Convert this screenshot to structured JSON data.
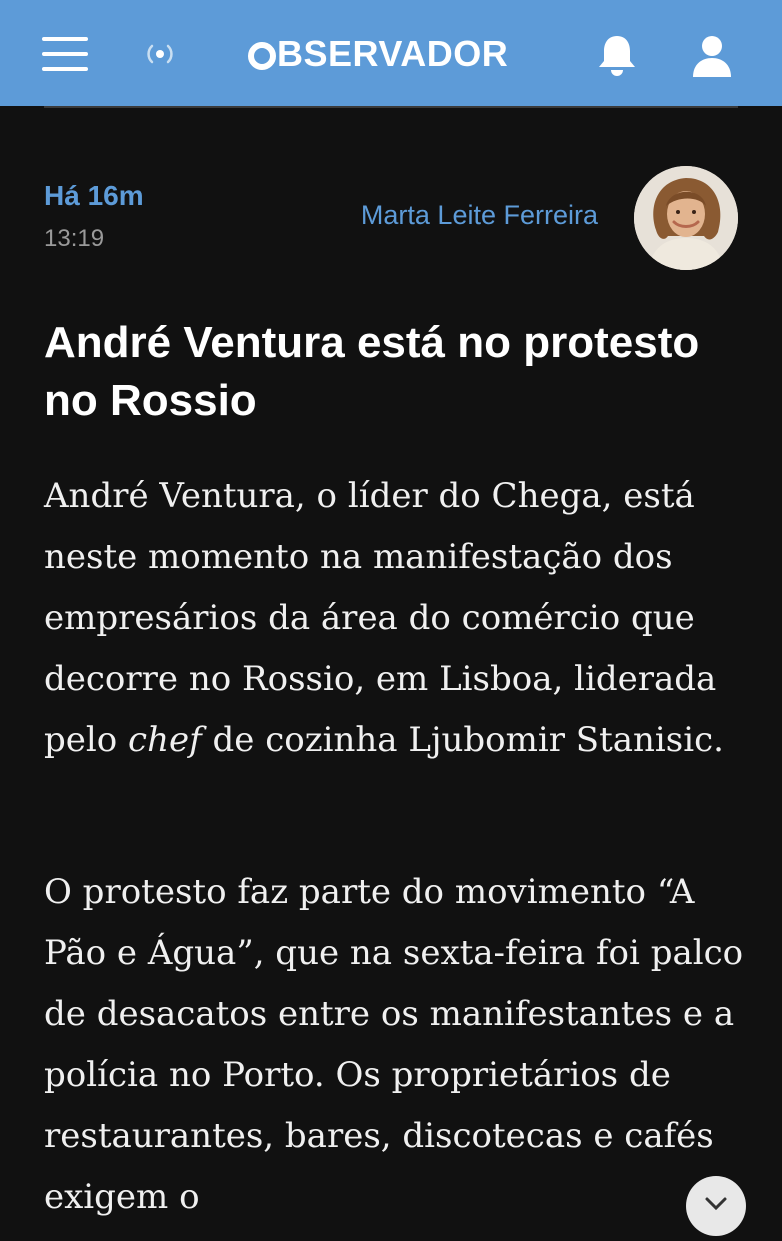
{
  "header": {
    "menu_icon": "hamburger-menu-icon",
    "live_icon": "live-radio-icon",
    "logo_text": "BSERVADOR",
    "notification_icon": "bell-icon",
    "profile_icon": "user-icon",
    "bar_color": "#5d9bd8"
  },
  "post": {
    "time_ago": "Há 16m",
    "time": "13:19",
    "author": "Marta Leite Ferreira",
    "headline": "André Ventura está no protesto no Rossio",
    "paragraph1_before": "André Ventura, o líder do Chega, está neste momento na manifestação dos empresários da área do comércio que decorre no Rossio, em Lisboa, liderada pelo ",
    "paragraph1_italic": "chef",
    "paragraph1_after": " de cozinha Ljubomir Stanisic.",
    "paragraph2": "O protesto faz parte do movimento “A Pão e Água”, que na sexta-feira foi palco de desacatos entre os manifestantes e a polícia no Porto. Os proprietários de restaurantes, bares, discotecas e cafés exigem o",
    "accent_color": "#5d9bd8"
  },
  "fab": {
    "icon": "chevron-down-icon"
  }
}
